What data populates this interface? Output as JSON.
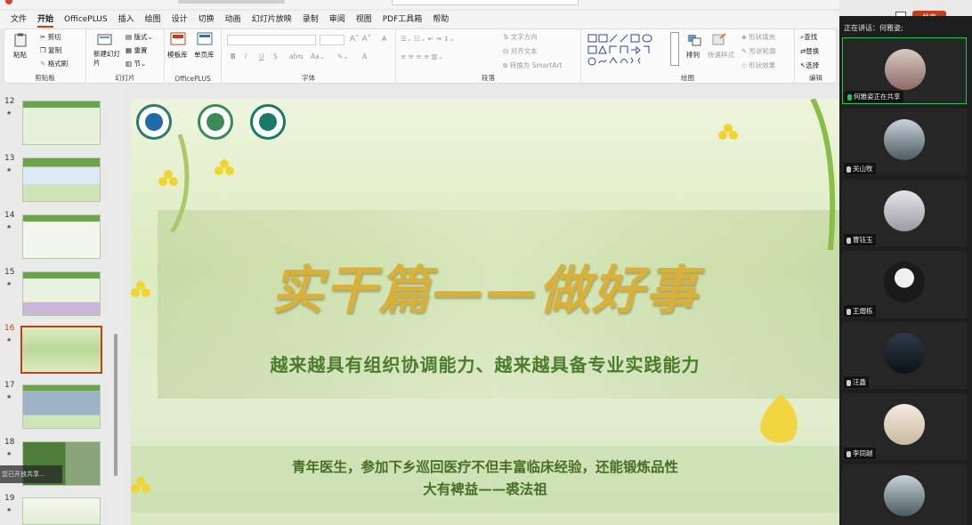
{
  "menu": {
    "items": [
      "文件",
      "开始",
      "OfficePLUS",
      "插入",
      "绘图",
      "设计",
      "切换",
      "动画",
      "幻灯片放映",
      "录制",
      "审阅",
      "视图",
      "PDF工具箱",
      "帮助"
    ],
    "active_index": 1,
    "share_label": "共享",
    "accent_color": "#c43e1c"
  },
  "ribbon": {
    "clipboard": {
      "paste": "粘贴",
      "cut": "剪切",
      "copy": "复制",
      "format_painter": "格式刷",
      "label": "剪贴板"
    },
    "slides": {
      "new_slide": "新建幻灯片",
      "layout": "版式",
      "reset": "重置",
      "section": "节",
      "label": "幻灯片"
    },
    "officeplus": {
      "template_lib": "模板库",
      "single_page_lib": "单页库",
      "label": "OfficePLUS"
    },
    "font": {
      "bold": "B",
      "italic": "I",
      "underline": "U",
      "strike": "S",
      "font_btn": "A",
      "label": "字体"
    },
    "paragraph": {
      "text_direction": "文字方向",
      "align_text": "对齐文本",
      "smartart": "转换为 SmartArt",
      "label": "段落"
    },
    "drawing": {
      "arrange": "排列",
      "quick_styles": "快速样式",
      "shape_fill": "形状填充",
      "shape_outline": "形状轮廓",
      "shape_effects": "形状效果",
      "label": "绘图"
    },
    "editing": {
      "find": "查找",
      "replace": "替换",
      "select": "选择",
      "label": "编辑"
    }
  },
  "thumbnails": {
    "items": [
      {
        "num": "12"
      },
      {
        "num": "13"
      },
      {
        "num": "14"
      },
      {
        "num": "15"
      },
      {
        "num": "16"
      },
      {
        "num": "17"
      },
      {
        "num": "18"
      },
      {
        "num": "19"
      }
    ],
    "active_num": "16",
    "overlay_text": "您已开放共享..."
  },
  "slide": {
    "title": "实干篇——做好事",
    "subtitle": "越来越具有组织协调能力、越来越具备专业实践能力",
    "quote_line1": "青年医生，参加下乡巡回医疗不但丰富临床经验，还能锻炼品性",
    "quote_line2": "大有裨益——裘法祖",
    "title_color": "#d9b13a",
    "text_color": "#466f25"
  },
  "meeting": {
    "speaking_label": "正在讲话：何雅姿;",
    "participants": [
      {
        "name": "何雅姿正在共享",
        "sharing": true
      },
      {
        "name": "关山牧",
        "sharing": false
      },
      {
        "name": "曹钰玉",
        "sharing": false
      },
      {
        "name": "王熠栋",
        "sharing": false
      },
      {
        "name": "汪鑫",
        "sharing": false
      },
      {
        "name": "李同越",
        "sharing": false
      },
      {
        "name": "",
        "sharing": false
      }
    ],
    "sharing_color": "#2bbf5c"
  }
}
